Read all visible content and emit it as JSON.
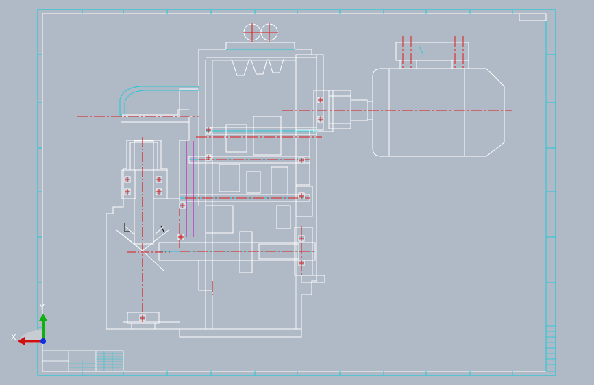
{
  "viewport": {
    "background_color": "#b0bac6",
    "sheet_frame_color": "#20c8d8",
    "line_color": "#ffffff",
    "centerline_color": "#e01818",
    "highlight_color": "#c020c0"
  },
  "axis_triad": {
    "x_label": "X",
    "y_label": "Y",
    "x_color": "#d01010",
    "y_color": "#10b010",
    "z_color": "#1030e0"
  }
}
